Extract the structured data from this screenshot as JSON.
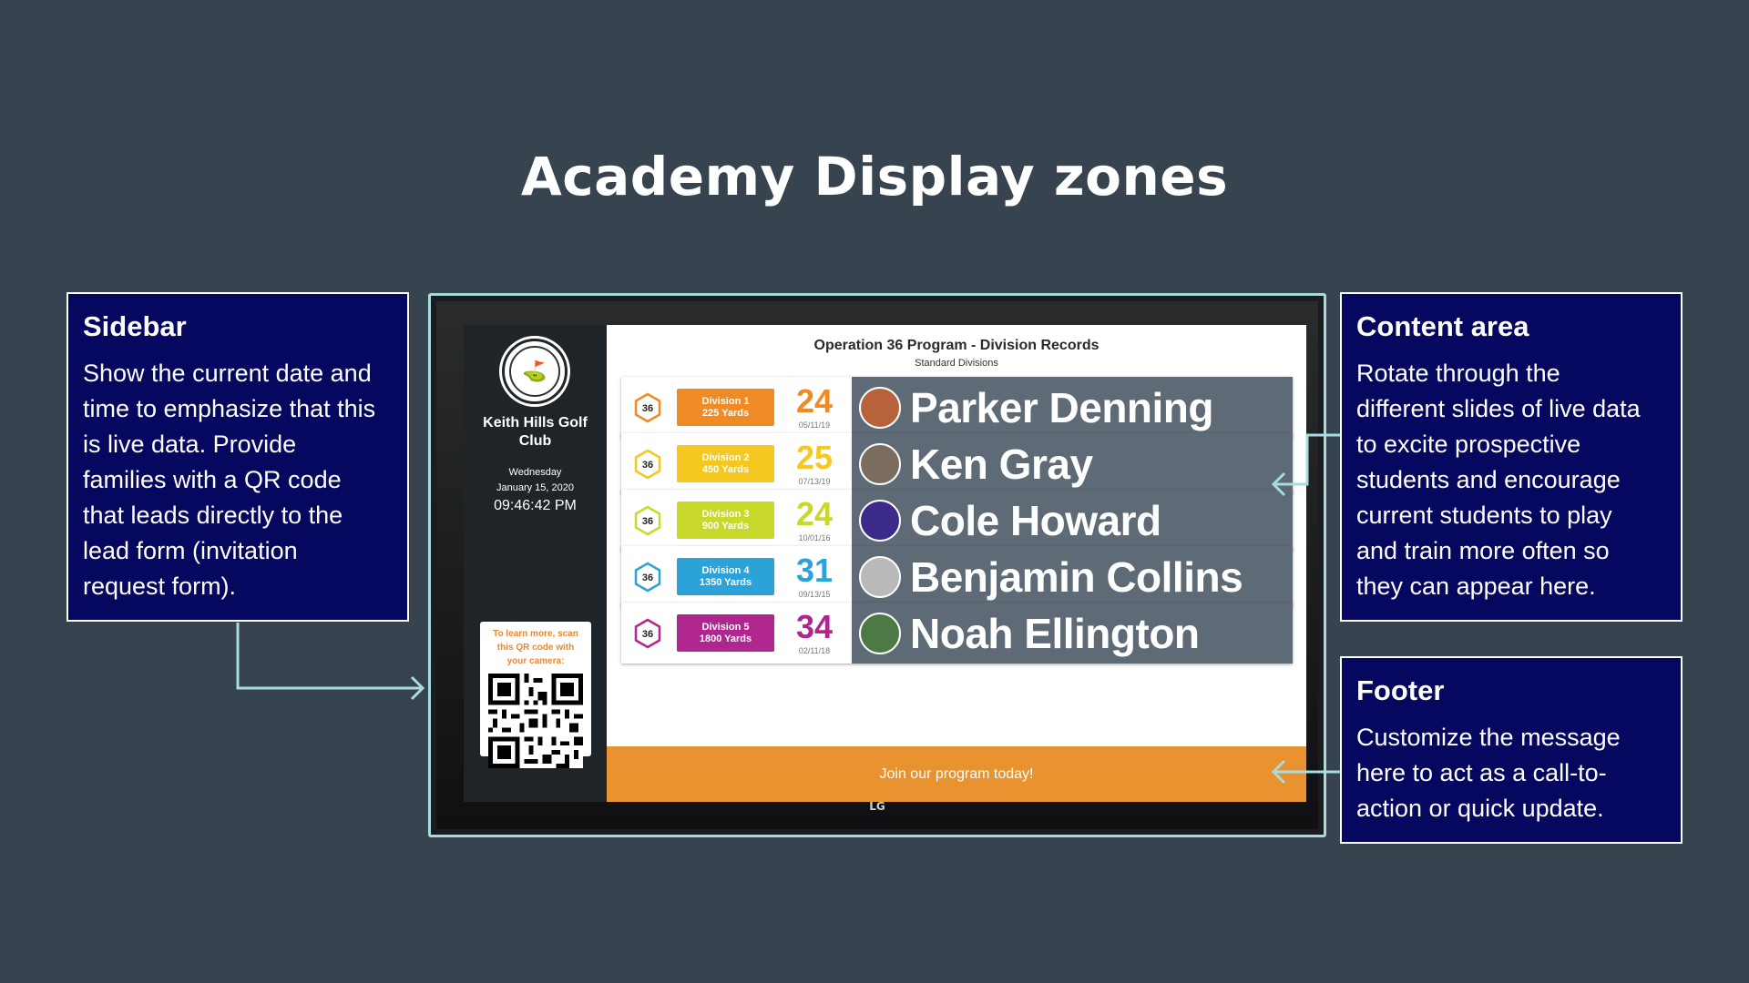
{
  "title": "Academy Display zones",
  "callouts": {
    "sidebar": {
      "heading": "Sidebar",
      "lines": [
        "Show the current date and",
        "time to emphasize that this",
        "is live data. Provide",
        "families with a QR code",
        "that leads directly to the",
        "lead form (invitation",
        "request form)."
      ]
    },
    "content": {
      "heading": "Content area",
      "lines": [
        "Rotate through the",
        "different slides of live data",
        "to excite prospective",
        "students and encourage",
        "current students to play",
        "and train more often so",
        "they can appear here."
      ]
    },
    "footer": {
      "heading": "Footer",
      "lines": [
        "Customize the message",
        "here to act as a call-to-",
        "action or quick update."
      ]
    }
  },
  "tv": {
    "brand": "LG",
    "sidebar": {
      "club_name": "Keith Hills Golf Club",
      "day": "Wednesday",
      "date": "January 15, 2020",
      "time": "09:46:42 PM",
      "qr_text": "To learn more, scan this QR code with your camera:"
    },
    "content": {
      "title": "Operation 36 Program - Division Records",
      "subtitle": "Standard Divisions",
      "records": [
        {
          "badge": "36",
          "division": "Division 1",
          "yards": "225 Yards",
          "color": "#f08a24",
          "score": "24",
          "date": "05/11/19",
          "name": "Parker Denning",
          "avatar_color": "#b8623b"
        },
        {
          "badge": "36",
          "division": "Division 2",
          "yards": "450 Yards",
          "color": "#f4c81f",
          "score": "25",
          "date": "07/13/19",
          "name": "Ken Gray",
          "avatar_color": "#7a6c5e"
        },
        {
          "badge": "36",
          "division": "Division 3",
          "yards": "900 Yards",
          "color": "#c8d92b",
          "score": "24",
          "date": "10/01/16",
          "name": "Cole Howard",
          "avatar_color": "#3b2a8a"
        },
        {
          "badge": "36",
          "division": "Division 4",
          "yards": "1350 Yards",
          "color": "#2ba3d9",
          "score": "31",
          "date": "09/13/15",
          "name": "Benjamin Collins",
          "avatar_color": "#b9b9b9"
        },
        {
          "badge": "36",
          "division": "Division 5",
          "yards": "1800 Yards",
          "color": "#b0268f",
          "score": "34",
          "date": "02/11/18",
          "name": "Noah Ellington",
          "avatar_color": "#4c7a45"
        }
      ]
    },
    "footer": "Join our program today!"
  }
}
